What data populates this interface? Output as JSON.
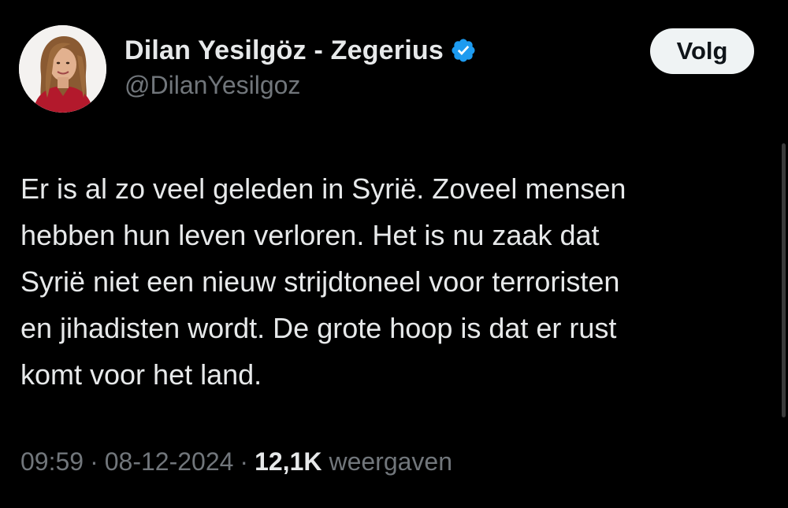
{
  "author": {
    "display_name": "Dilan Yesilgöz - Zegerius",
    "handle": "@DilanYesilgoz",
    "verified": true,
    "verified_color": "#1d9bf0"
  },
  "follow_button": {
    "label": "Volg"
  },
  "tweet": {
    "lines": [
      "Er is al zo veel geleden in Syrië. Zoveel mensen",
      "hebben hun leven verloren. Het is nu zaak dat",
      "Syrië niet een nieuw strijdtoneel voor terroristen",
      "en jihadisten wordt. De grote hoop is dat er rust",
      "komt voor het land."
    ]
  },
  "meta": {
    "time": "09:59",
    "date": "08-12-2024",
    "separator": "·",
    "views_count": "12,1K",
    "views_label": "weergaven"
  },
  "icons": {
    "avatar": "profile-photo",
    "verified": "verified-badge-icon"
  },
  "colors": {
    "background": "#000000",
    "text_primary": "#e7e9ea",
    "text_secondary": "#71767b",
    "follow_bg": "#eff3f4",
    "follow_text": "#0f1419"
  }
}
